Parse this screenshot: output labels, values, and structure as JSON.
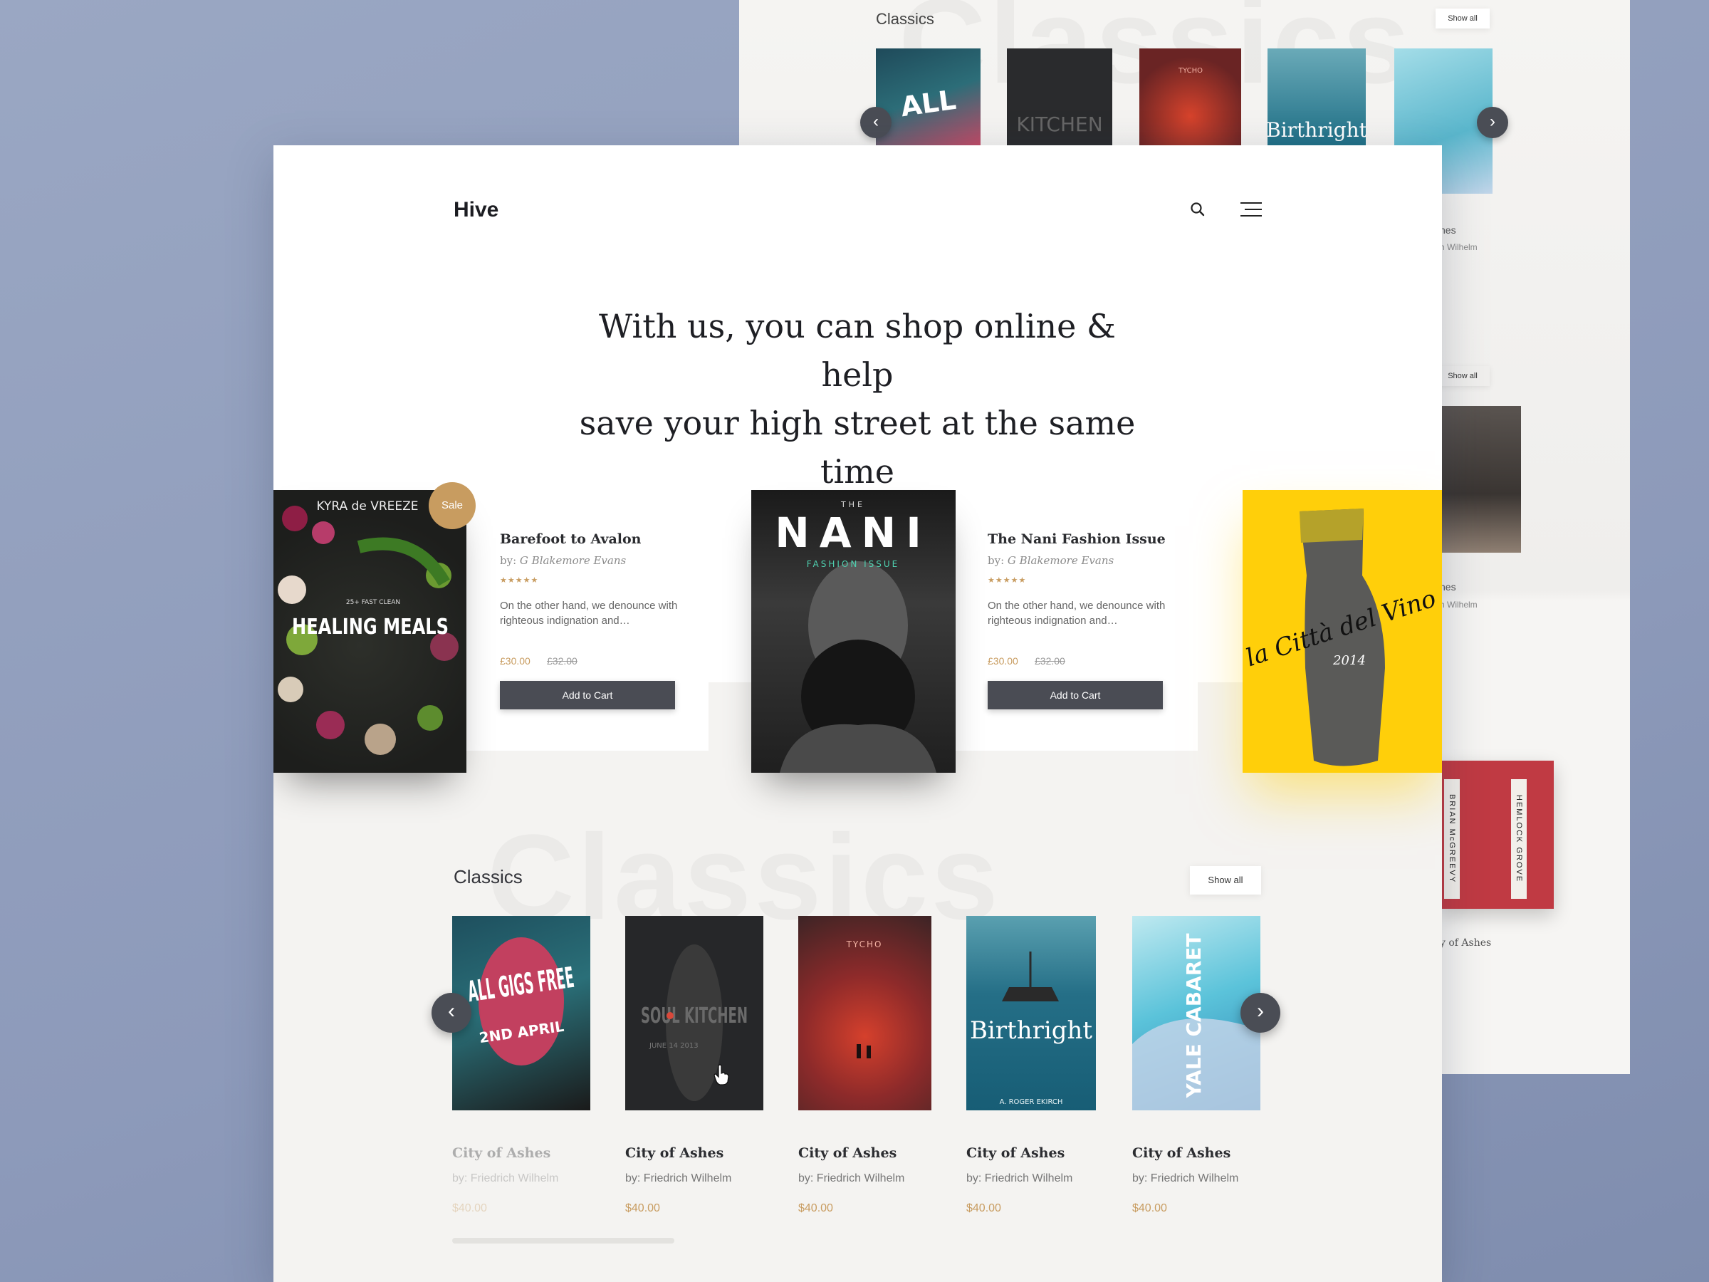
{
  "brand": {
    "logo": "Hive"
  },
  "hero": {
    "line1": "With us, you can shop online & help",
    "line2": "save your high street at the same time"
  },
  "featured": [
    {
      "cover_title": "HEALING MEALS",
      "cover_author": "KYRA de VREEZE",
      "cover_tagline": "25+ FAST CLEAN",
      "badge": "Sale",
      "title": "Barefoot to Avalon",
      "by_label": "by:",
      "author": "G Blakemore Evans",
      "stars": "★★★★★",
      "description": "On the other hand, we denounce with righteous indignation and…",
      "price": "£30.00",
      "old_price": "£32.00",
      "button": "Add to Cart"
    },
    {
      "cover_title": "NANI",
      "cover_top": "THE",
      "cover_sub": "FASHION ISSUE",
      "title": "The Nani Fashion Issue",
      "by_label": "by:",
      "author": "G Blakemore Evans",
      "stars": "★★★★★",
      "description": "On the other hand, we denounce with righteous indignation and…",
      "price": "£30.00",
      "old_price": "£32.00",
      "button": "Add to Cart"
    },
    {
      "cover_title": "la Città del Vino",
      "cover_year": "2014"
    }
  ],
  "classics": {
    "heading": "Classics",
    "watermark": "Classics",
    "show_all": "Show all",
    "books": [
      {
        "cover": "ALL GIGS FREE",
        "cover_sub": "2ND APRIL",
        "title": "City of Ashes",
        "author": "by: Friedrich Wilhelm",
        "price": "$40.00"
      },
      {
        "cover": "SOUL KITCHEN",
        "cover_sub": "JUNE 14 2013",
        "title": "City of Ashes",
        "author": "by: Friedrich Wilhelm",
        "price": "$40.00"
      },
      {
        "cover": "TYCHO",
        "title": "City of Ashes",
        "author": "by: Friedrich Wilhelm",
        "price": "$40.00"
      },
      {
        "cover": "Birthright",
        "cover_sub": "A. ROGER EKIRCH",
        "title": "City of Ashes",
        "author": "by: Friedrich Wilhelm",
        "price": "$40.00"
      },
      {
        "cover": "YALE CABARET",
        "title": "City of Ashes",
        "author": "by: Friedrich Wilhelm",
        "price": "$40.00"
      }
    ]
  },
  "background_window": {
    "heading": "Classics",
    "show_all": "Show all",
    "meta_title_1": "hes",
    "meta_author_1": "h Wilhelm",
    "meta_title_2": "hes",
    "meta_author_2": "h Wilhelm",
    "meta_title_3": "y of Ashes",
    "hemlock_left": "BRIAN McGREEVY",
    "hemlock_right": "HEMLOCK GROVE"
  },
  "colors": {
    "accent": "#c89c60",
    "button": "#4a4c54",
    "backdrop": "#9aa7c3",
    "vino": "#ffcf0a"
  }
}
